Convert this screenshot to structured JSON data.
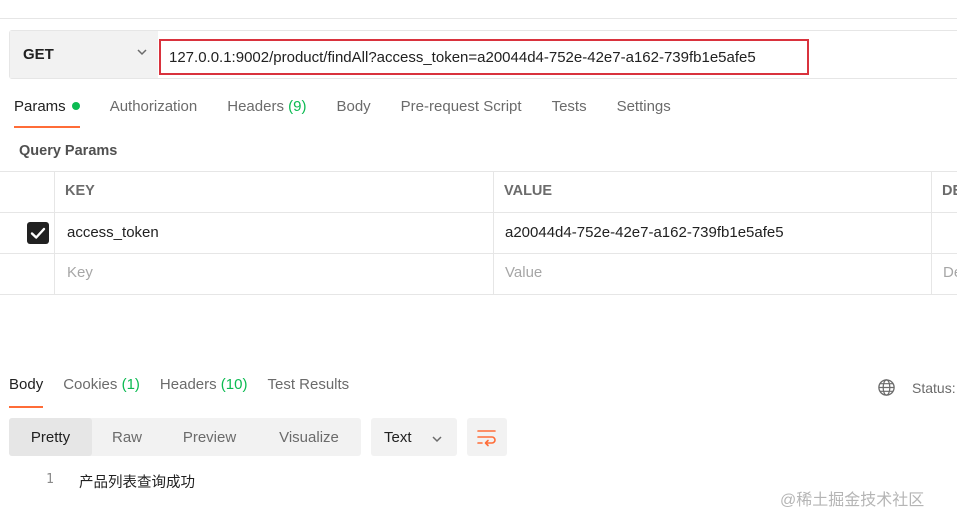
{
  "request": {
    "method": "GET",
    "url": "127.0.0.1:9002/product/findAll?access_token=a20044d4-752e-42e7-a162-739fb1e5afe5"
  },
  "request_tabs": [
    {
      "label": "Params",
      "count": "",
      "active": true,
      "dot": true
    },
    {
      "label": "Authorization",
      "count": ""
    },
    {
      "label": "Headers",
      "count": "(9)"
    },
    {
      "label": "Body",
      "count": ""
    },
    {
      "label": "Pre-request Script",
      "count": ""
    },
    {
      "label": "Tests",
      "count": ""
    },
    {
      "label": "Settings",
      "count": ""
    }
  ],
  "query_params": {
    "title": "Query Params",
    "columns": [
      "KEY",
      "VALUE",
      "DE"
    ],
    "rows": [
      {
        "checked": true,
        "key": "access_token",
        "value": "a20044d4-752e-42e7-a162-739fb1e5afe5"
      }
    ],
    "placeholder": {
      "key": "Key",
      "value": "Value",
      "desc": "De"
    }
  },
  "response_tabs": [
    {
      "label": "Body",
      "count": "",
      "active": true
    },
    {
      "label": "Cookies",
      "count": "(1)"
    },
    {
      "label": "Headers",
      "count": "(10)"
    },
    {
      "label": "Test Results",
      "count": ""
    }
  ],
  "status_label": "Status:",
  "view_modes": [
    "Pretty",
    "Raw",
    "Preview",
    "Visualize"
  ],
  "format": "Text",
  "response_body": [
    {
      "line": "1",
      "text": "产品列表查询成功"
    }
  ],
  "watermark": "@稀土掘金技术社区",
  "colors": {
    "accent": "#ff6c37",
    "success": "#0cbb52",
    "highlight_border": "#d9323d"
  },
  "icons": [
    "chevron-down-icon",
    "check-icon",
    "globe-icon",
    "wrap-lines-icon"
  ]
}
